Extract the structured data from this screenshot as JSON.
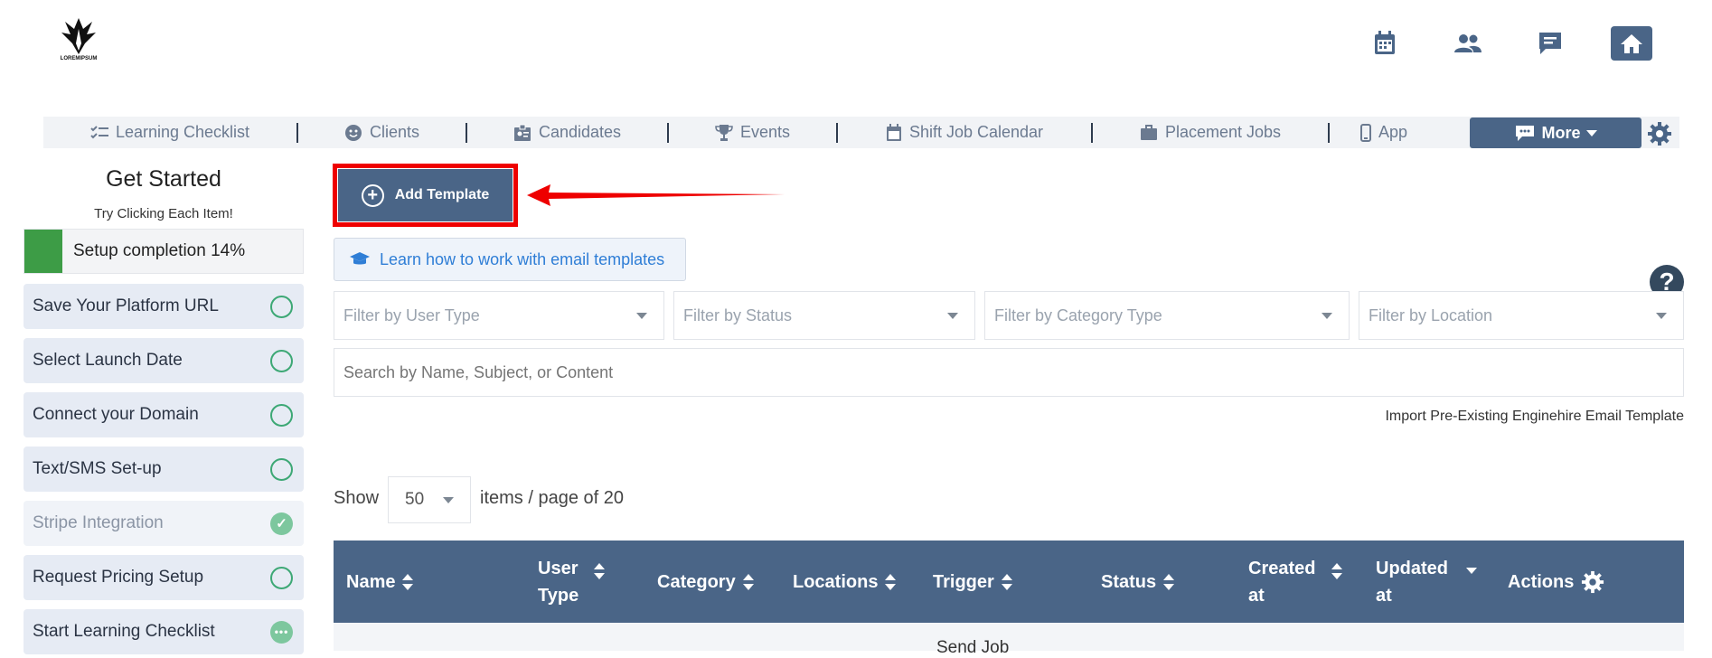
{
  "logo": {
    "text": "LOREMIPSUM"
  },
  "header_icons": [
    "calendar-icon",
    "users-icon",
    "chat-icon",
    "home-icon"
  ],
  "nav": {
    "items": [
      {
        "label": "Learning Checklist",
        "icon": "checklist-icon"
      },
      {
        "label": "Clients",
        "icon": "smiley-icon"
      },
      {
        "label": "Candidates",
        "icon": "badge-icon"
      },
      {
        "label": "Events",
        "icon": "trophy-icon"
      },
      {
        "label": "Shift Job Calendar",
        "icon": "calendar-icon"
      },
      {
        "label": "Placement Jobs",
        "icon": "briefcase-icon"
      },
      {
        "label": "App",
        "icon": "phone-icon"
      }
    ],
    "more_label": "More"
  },
  "sidebar": {
    "title": "Get Started",
    "subtitle": "Try Clicking Each Item!",
    "progress_label": "Setup completion 14%",
    "progress_percent": 14,
    "items": [
      {
        "label": "Save Your Platform URL",
        "status": "pending"
      },
      {
        "label": "Select Launch Date",
        "status": "pending"
      },
      {
        "label": "Connect your Domain",
        "status": "pending"
      },
      {
        "label": "Text/SMS Set-up",
        "status": "pending"
      },
      {
        "label": "Stripe Integration",
        "status": "done"
      },
      {
        "label": "Request Pricing Setup",
        "status": "pending"
      },
      {
        "label": "Start Learning Checklist",
        "status": "in-progress"
      }
    ]
  },
  "main": {
    "add_template_label": "Add Template",
    "learn_label": "Learn how to work with email templates",
    "help_label": "?",
    "filters": [
      {
        "placeholder": "Filter by User Type"
      },
      {
        "placeholder": "Filter by Status"
      },
      {
        "placeholder": "Filter by Category Type"
      },
      {
        "placeholder": "Filter by Location"
      }
    ],
    "search_placeholder": "Search by Name, Subject, or Content",
    "import_label": "Import Pre-Existing Enginehire Email Template",
    "show_label": "Show",
    "page_size": "50",
    "items_label": "items / page of 20",
    "table": {
      "columns": [
        {
          "label": "Name",
          "sort": "both"
        },
        {
          "label": "User Type",
          "sort": "both"
        },
        {
          "label": "Category",
          "sort": "both"
        },
        {
          "label": "Locations",
          "sort": "both"
        },
        {
          "label": "Trigger",
          "sort": "both"
        },
        {
          "label": "Status",
          "sort": "both"
        },
        {
          "label": "Created at",
          "sort": "both"
        },
        {
          "label": "Updated at",
          "sort": "desc"
        },
        {
          "label": "Actions",
          "sort": "none"
        }
      ],
      "first_row_peek": "Send Job"
    }
  },
  "colors": {
    "primary": "#4a6587",
    "highlight_red": "#ee0000",
    "progress_green": "#3d9c46",
    "link_blue": "#2f7ed6",
    "check_green": "#3da875"
  }
}
